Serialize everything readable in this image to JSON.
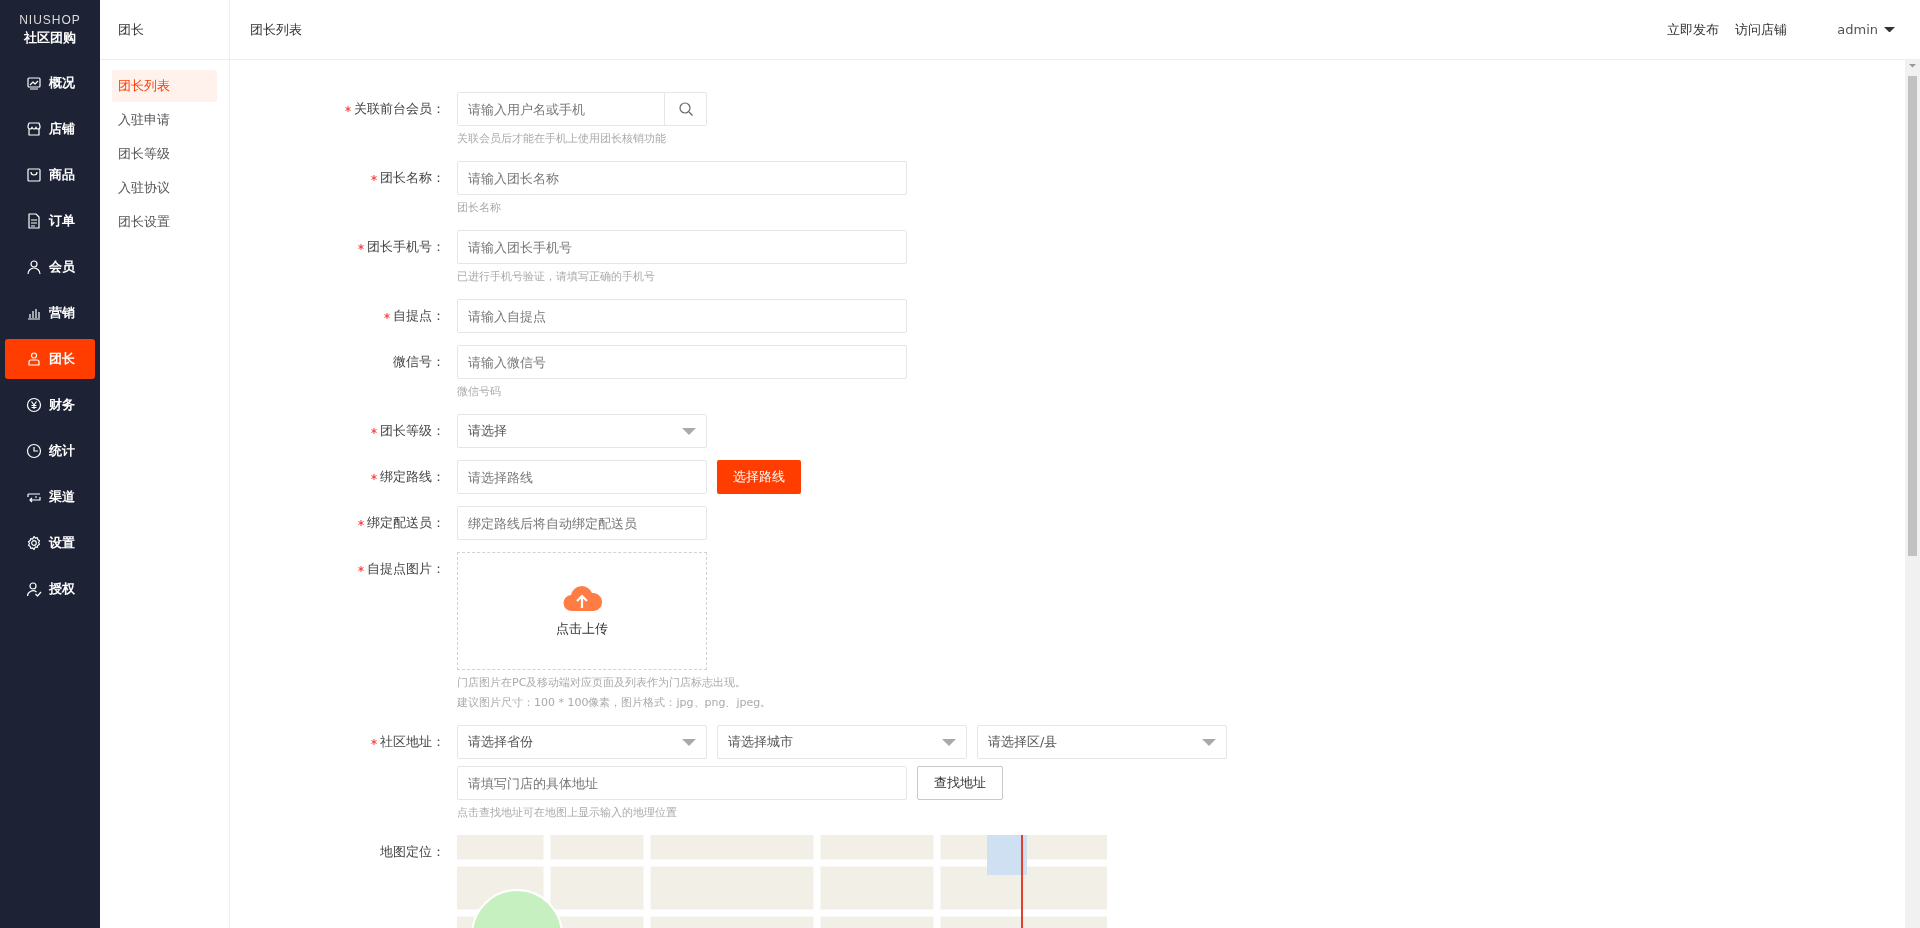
{
  "brand": {
    "logo": "NIUSHOP",
    "subtitle": "社区团购"
  },
  "nav": [
    {
      "label": "概况",
      "selected": false
    },
    {
      "label": "店铺",
      "selected": false
    },
    {
      "label": "商品",
      "selected": false
    },
    {
      "label": "订单",
      "selected": false
    },
    {
      "label": "会员",
      "selected": false
    },
    {
      "label": "营销",
      "selected": false
    },
    {
      "label": "团长",
      "selected": true
    },
    {
      "label": "财务",
      "selected": false
    },
    {
      "label": "统计",
      "selected": false
    },
    {
      "label": "渠道",
      "selected": false
    },
    {
      "label": "设置",
      "selected": false
    },
    {
      "label": "授权",
      "selected": false
    }
  ],
  "subnav": {
    "title": "团长",
    "items": [
      {
        "label": "团长列表",
        "selected": true
      },
      {
        "label": "入驻申请",
        "selected": false
      },
      {
        "label": "团长等级",
        "selected": false
      },
      {
        "label": "入驻协议",
        "selected": false
      },
      {
        "label": "团长设置",
        "selected": false
      }
    ]
  },
  "header": {
    "title": "团长列表",
    "links": [
      "立即发布",
      "访问店铺"
    ],
    "user": "admin"
  },
  "form": [
    {
      "kind": "search",
      "label": "关联前台会员：",
      "required": true,
      "placeholder": "请输入用户名或手机",
      "hints": [
        "关联会员后才能在手机上使用团长核销功能"
      ]
    },
    {
      "kind": "input",
      "label": "团长名称：",
      "required": true,
      "placeholder": "请输入团长名称",
      "hints": [
        "团长名称"
      ]
    },
    {
      "kind": "input",
      "label": "团长手机号：",
      "required": true,
      "placeholder": "请输入团长手机号",
      "hints": [
        "已进行手机号验证，请填写正确的手机号"
      ]
    },
    {
      "kind": "input",
      "label": "自提点：",
      "required": true,
      "placeholder": "请输入自提点"
    },
    {
      "kind": "input",
      "label": "微信号：",
      "required": false,
      "placeholder": "请输入微信号",
      "hints": [
        "微信号码"
      ]
    },
    {
      "kind": "select",
      "label": "团长等级：",
      "required": true,
      "value": "请选择"
    },
    {
      "kind": "picker",
      "label": "绑定路线：",
      "required": true,
      "placeholder": "请选择路线",
      "button": "选择路线"
    },
    {
      "kind": "short",
      "label": "绑定配送员：",
      "required": true,
      "placeholder": "绑定路线后将自动绑定配送员"
    },
    {
      "kind": "upload",
      "label": "自提点图片：",
      "required": true,
      "button": "点击上传",
      "hints": [
        "门店图片在PC及移动端对应页面及列表作为门店标志出现。",
        "建议图片尺寸：100 * 100像素，图片格式：jpg、png、jpeg。"
      ]
    },
    {
      "kind": "address",
      "label": "社区地址：",
      "required": true,
      "selects": [
        "请选择省份",
        "请选择城市",
        "请选择区/县"
      ],
      "placeholder": "请填写门店的具体地址",
      "button": "查找地址",
      "hints": [
        "点击查找地址可在地图上显示输入的地理位置"
      ]
    },
    {
      "kind": "map",
      "label": "地图定位：",
      "required": false
    }
  ]
}
